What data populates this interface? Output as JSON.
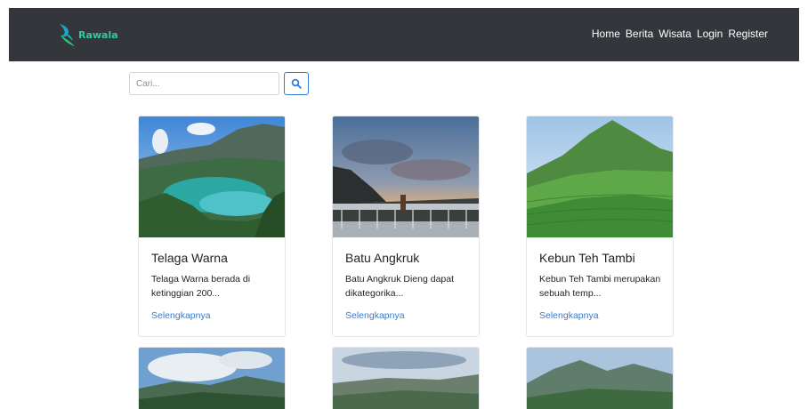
{
  "navbar": {
    "brand": "Rawala",
    "links": [
      "Home",
      "Berita",
      "Wisata",
      "Login",
      "Register"
    ]
  },
  "search": {
    "placeholder": "Cari..."
  },
  "cards": [
    {
      "title": "Telaga Warna",
      "text": "Telaga Warna berada di ketinggian 200...",
      "link": "Selengkapnya"
    },
    {
      "title": "Batu Angkruk",
      "text": "Batu Angkruk Dieng dapat dikategorika...",
      "link": "Selengkapnya"
    },
    {
      "title": "Kebun Teh Tambi",
      "text": "Kebun Teh Tambi merupakan sebuah temp...",
      "link": "Selengkapnya"
    }
  ],
  "colors": {
    "navbar_bg": "#33363b",
    "brand": "#2ecc9a",
    "link": "#2f7cd9"
  }
}
